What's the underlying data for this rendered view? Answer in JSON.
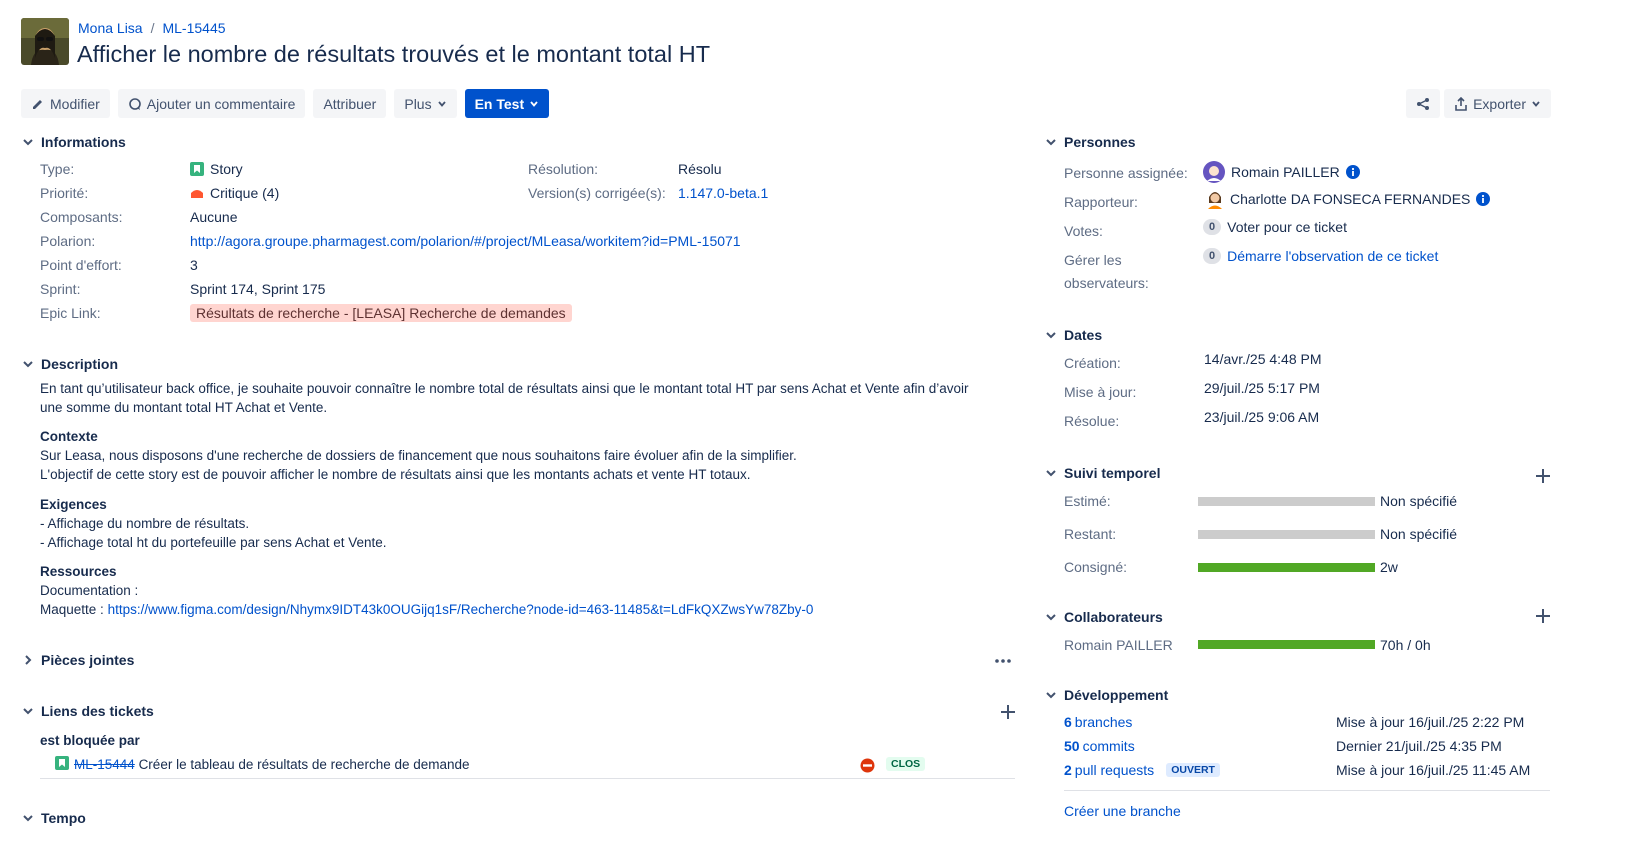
{
  "breadcrumb": {
    "project": "Mona Lisa",
    "sep": "/",
    "issue_key": "ML-15445"
  },
  "title": "Afficher le nombre de résultats trouvés et le montant total HT",
  "toolbar": {
    "edit": "Modifier",
    "comment": "Ajouter un commentaire",
    "assign": "Attribuer",
    "more": "Plus",
    "status": "En Test",
    "export": "Exporter"
  },
  "details": {
    "heading": "Informations",
    "type_label": "Type:",
    "type_value": "Story",
    "priority_label": "Priorité:",
    "priority_value": "Critique (4)",
    "components_label": "Composants:",
    "components_value": "Aucune",
    "polarion_label": "Polarion:",
    "polarion_value": "http://agora.groupe.pharmagest.com/polarion/#/project/MLeasa/workitem?id=PML-15071",
    "effort_label": "Point d'effort:",
    "effort_value": "3",
    "sprint_label": "Sprint:",
    "sprint_value": "Sprint 174, Sprint 175",
    "epic_label": "Epic Link:",
    "epic_value": "Résultats de recherche - [LEASA] Recherche de demandes",
    "resolution_label": "Résolution:",
    "resolution_value": "Résolu",
    "fixversion_label": "Version(s) corrigée(s):",
    "fixversion_value": "1.147.0-beta.1"
  },
  "description": {
    "heading": "Description",
    "intro1": "En tant qu’utilisateur back office, je souhaite pouvoir connaître le nombre total de résultats ainsi que le montant total HT par sens Achat et Vente afin d’avoir",
    "intro2": "une somme du montant total HT Achat et Vente.",
    "context_title": "Contexte",
    "context1": "Sur Leasa, nous disposons d'une recherche de dossiers de financement que nous souhaitons faire évoluer afin de la simplifier.",
    "context2": "L'objectif de cette story est de pouvoir afficher le nombre de résultats ainsi que les montants achats et vente HT totaux.",
    "req_title": "Exigences",
    "req1": "- Affichage du nombre de résultats.",
    "req2": "- Affichage total ht du portefeuille par sens Achat et Vente.",
    "res_title": "Ressources",
    "res_doc": "Documentation :",
    "res_mock_label": "Maquette :",
    "res_mock_link": "https://www.figma.com/design/Nhymx9IDT43k0OUGijq1sF/Recherche?node-id=463-11485&t=LdFkQXZwsYw78Zby-0"
  },
  "attachments": {
    "heading": "Pièces jointes"
  },
  "links": {
    "heading": "Liens des tickets",
    "relation": "est bloquée par",
    "item_key": "ML-15444",
    "item_summary": "Créer le tableau de résultats de recherche de demande",
    "item_status": "CLOS"
  },
  "tempo": {
    "heading": "Tempo"
  },
  "people": {
    "heading": "Personnes",
    "assignee_label": "Personne assignée:",
    "assignee": "Romain PAILLER",
    "reporter_label": "Rapporteur:",
    "reporter": "Charlotte DA FONSECA FERNANDES",
    "votes_label": "Votes:",
    "votes_count": "0",
    "votes_action": "Voter pour ce ticket",
    "watchers_label1": "Gérer les",
    "watchers_label2": "observateurs:",
    "watchers_count": "0",
    "watchers_action": "Démarre l'observation de ce ticket"
  },
  "dates": {
    "heading": "Dates",
    "created_label": "Création:",
    "created": "14/avr./25 4:48 PM",
    "updated_label": "Mise à jour:",
    "updated": "29/juil./25 5:17 PM",
    "resolved_label": "Résolue:",
    "resolved": "23/juil./25 9:06 AM"
  },
  "time_tracking": {
    "heading": "Suivi temporel",
    "estimated_label": "Estimé:",
    "estimated": "Non spécifié",
    "estimated_fill": 0,
    "remaining_label": "Restant:",
    "remaining": "Non spécifié",
    "remaining_fill": 0,
    "logged_label": "Consigné:",
    "logged": "2w",
    "logged_fill": 1.0
  },
  "collaborators": {
    "heading": "Collaborateurs",
    "name": "Romain PAILLER",
    "value": "70h / 0h",
    "fill": 1.0
  },
  "development": {
    "heading": "Développement",
    "branches_count": "6",
    "branches_label": "branches",
    "branches_meta": "Mise à jour 16/juil./25 2:22 PM",
    "commits_count": "50",
    "commits_label": "commits",
    "commits_meta": "Dernier 21/juil./25 4:35 PM",
    "pr_count": "2",
    "pr_label": "pull requests",
    "pr_status": "OUVERT",
    "pr_meta": "Mise à jour 16/juil./25 11:45 AM",
    "create_branch": "Créer une branche"
  },
  "colors": {
    "accent": "#0052cc",
    "bar_empty": "#cccccc",
    "bar_done": "#51a825"
  }
}
